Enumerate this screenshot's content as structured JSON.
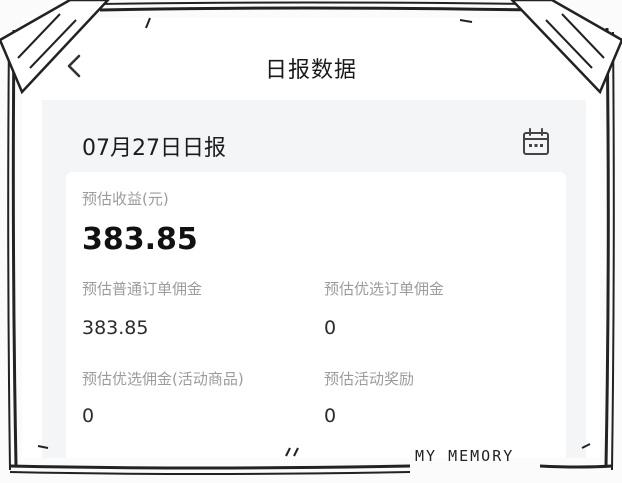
{
  "header": {
    "title": "日报数据",
    "back_icon": "chevron-left-icon"
  },
  "report": {
    "date_title": "07月27日日报",
    "calendar_icon": "calendar-icon",
    "estimated_income": {
      "label": "预估收益(元)",
      "value": "383.85"
    },
    "metrics": [
      {
        "label": "预估普通订单佣金",
        "value": "383.85"
      },
      {
        "label": "预估优选订单佣金",
        "value": "0"
      },
      {
        "label": "预估优选佣金(活动商品)",
        "value": "0"
      },
      {
        "label": "预估活动奖励",
        "value": "0"
      }
    ]
  },
  "watermark": "MY MEMORY"
}
